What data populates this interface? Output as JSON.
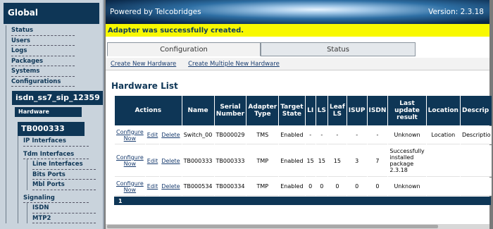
{
  "sidebar": {
    "global": "Global",
    "global_items": [
      "Status",
      "Users",
      "Logs",
      "Packages",
      "Systems",
      "Configurations"
    ],
    "system": "isdn_ss7_sip_12359",
    "hardware": "Hardware",
    "adapter": "TB000333",
    "ip_interfaces": "IP Interfaces",
    "tdm_interfaces": "Tdm Interfaces",
    "tdm_items": [
      "Line Interfaces",
      "Bits Ports",
      "Mbl Ports"
    ],
    "signaling": "Signaling",
    "signaling_items": [
      "ISDN",
      "MTP2"
    ]
  },
  "banner": {
    "powered": "Powered by Telcobridges",
    "version": "Version: 2.3.18"
  },
  "notice": "Adapter was successfully created.",
  "tabs": [
    "Configuration",
    "Status"
  ],
  "links": [
    "Create New Hardware",
    "Create Multiple New Hardware"
  ],
  "hw_title": "Hardware List",
  "table": {
    "headers": [
      "Actions",
      "Name",
      "Serial Number",
      "Adapter Type",
      "Target State",
      "LI",
      "LS",
      "Leaf LS",
      "ISUP",
      "ISDN",
      "Last update result",
      "Location",
      "Descrip"
    ],
    "rows": [
      {
        "configure": "Configure Now",
        "edit": "Edit",
        "delete": "Delete",
        "name": "Switch_00",
        "serial": "TB000029",
        "type": "TMS",
        "state": "Enabled",
        "li": "-",
        "ls": "-",
        "leaf": "-",
        "isup": "-",
        "isdn": "-",
        "result": "Unknown",
        "location": "Location",
        "desc": "Descriptio"
      },
      {
        "configure": "Configure Now",
        "edit": "Edit",
        "delete": "Delete",
        "name": "TB000333",
        "serial": "TB000333",
        "type": "TMP",
        "state": "Enabled",
        "li": "15",
        "ls": "15",
        "leaf": "15",
        "isup": "3",
        "isdn": "7",
        "result": "Successfully installed package 2.3.18",
        "location": "",
        "desc": ""
      },
      {
        "configure": "Configure Now",
        "edit": "Edit",
        "delete": "Delete",
        "name": "TB000534",
        "serial": "TB000334",
        "type": "TMP",
        "state": "Enabled",
        "li": "0",
        "ls": "0",
        "leaf": "0",
        "isup": "0",
        "isdn": "0",
        "result": "Unknown",
        "location": "",
        "desc": ""
      }
    ],
    "page": "1"
  }
}
